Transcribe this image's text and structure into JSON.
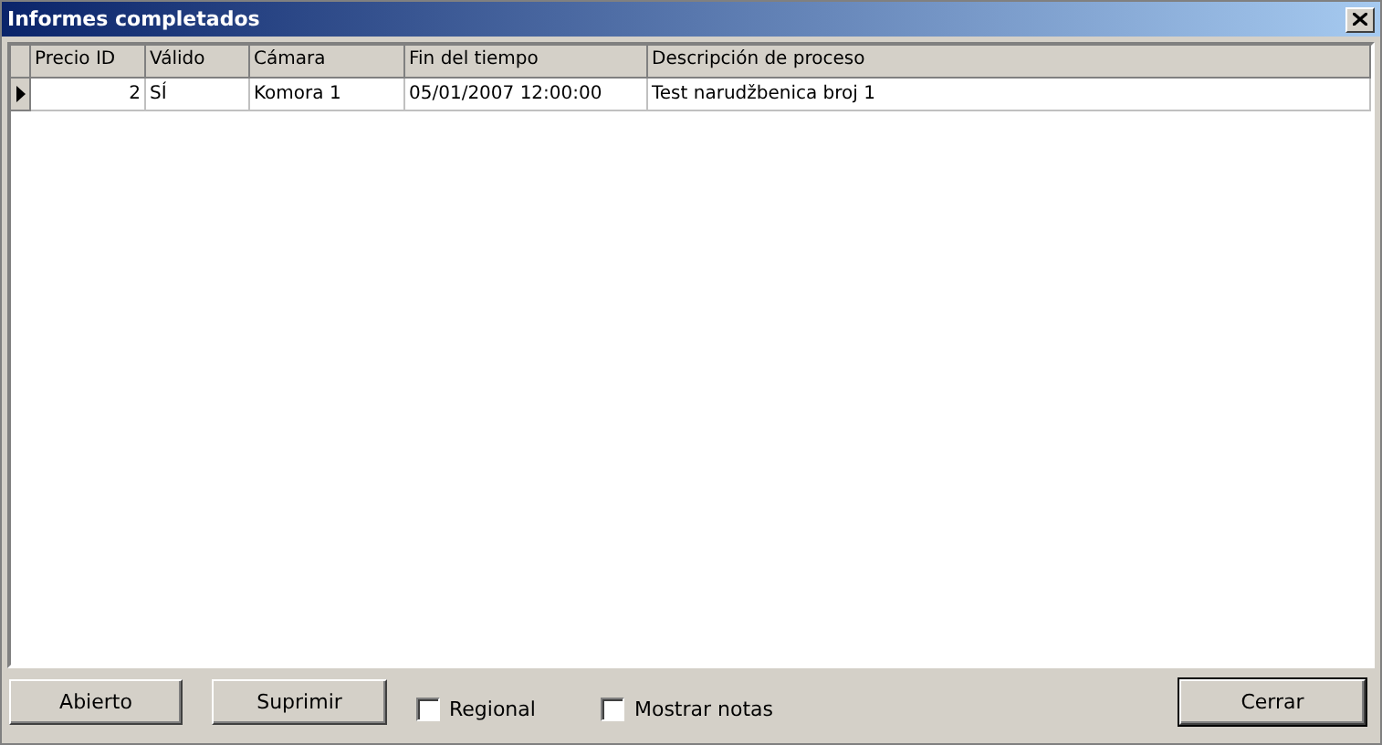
{
  "window": {
    "title": "Informes completados"
  },
  "table": {
    "columns": [
      {
        "label": "Precio ID",
        "kind": "number"
      },
      {
        "label": "Válido",
        "kind": "text"
      },
      {
        "label": "Cámara",
        "kind": "text"
      },
      {
        "label": "Fin del tiempo",
        "kind": "text"
      },
      {
        "label": "Descripción de proceso",
        "kind": "text"
      }
    ],
    "rows": [
      {
        "selected": true,
        "cells": [
          "2",
          "SÍ",
          "Komora 1",
          "05/01/2007 12:00:00",
          "Test narudžbenica broj 1"
        ]
      }
    ]
  },
  "buttons": [
    {
      "label": "Abierto",
      "default": false
    },
    {
      "label": "Suprimir",
      "default": false
    }
  ],
  "checkboxes": [
    {
      "label": "Regional",
      "checked": false
    },
    {
      "label": "Mostrar notas",
      "checked": false
    }
  ],
  "close_button": {
    "label": "Cerrar",
    "default": true
  }
}
